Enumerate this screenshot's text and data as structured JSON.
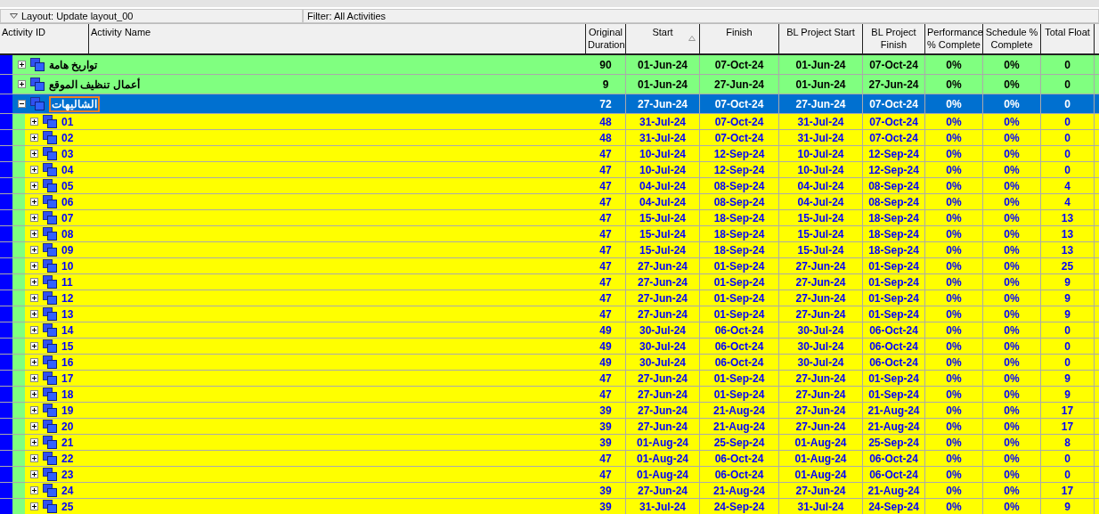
{
  "layout_bar": {
    "layout": "Layout: Update layout_00",
    "filter": "Filter: All Activities"
  },
  "table": {
    "columns": [
      {
        "label": "Activity ID",
        "sorted": false
      },
      {
        "label": "Activity Name",
        "sorted": false
      },
      {
        "label": "Original Duration",
        "sorted": false
      },
      {
        "label": "Start",
        "sorted": true
      },
      {
        "label": "Finish",
        "sorted": false
      },
      {
        "label": "BL Project Start",
        "sorted": false
      },
      {
        "label": "BL Project Finish",
        "sorted": false
      },
      {
        "label": "Performance % Complete",
        "sorted": false
      },
      {
        "label": "Schedule % Complete",
        "sorted": false
      },
      {
        "label": "Total Float",
        "sorted": false
      }
    ],
    "rows": [
      {
        "name": "تواريخ هامة",
        "expanded": false,
        "selected": false,
        "editing": false,
        "values": [
          "90",
          "01-Jun-24",
          "07-Oct-24",
          "01-Jun-24",
          "07-Oct-24",
          "0%",
          "0%",
          "0"
        ]
      },
      {
        "name": "أعمال تنظيف الموقع",
        "expanded": false,
        "selected": false,
        "editing": false,
        "values": [
          "9",
          "01-Jun-24",
          "27-Jun-24",
          "01-Jun-24",
          "27-Jun-24",
          "0%",
          "0%",
          "0"
        ]
      },
      {
        "name": "الشاليهات",
        "expanded": true,
        "selected": true,
        "editing": true,
        "values": [
          "72",
          "27-Jun-24",
          "07-Oct-24",
          "27-Jun-24",
          "07-Oct-24",
          "0%",
          "0%",
          "0"
        ],
        "children": [
          {
            "name": "01",
            "expanded": false,
            "selected": false,
            "editing": false,
            "values": [
              "48",
              "31-Jul-24",
              "07-Oct-24",
              "31-Jul-24",
              "07-Oct-24",
              "0%",
              "0%",
              "0"
            ]
          },
          {
            "name": "02",
            "expanded": false,
            "selected": false,
            "editing": false,
            "values": [
              "48",
              "31-Jul-24",
              "07-Oct-24",
              "31-Jul-24",
              "07-Oct-24",
              "0%",
              "0%",
              "0"
            ]
          },
          {
            "name": "03",
            "expanded": false,
            "selected": false,
            "editing": false,
            "values": [
              "47",
              "10-Jul-24",
              "12-Sep-24",
              "10-Jul-24",
              "12-Sep-24",
              "0%",
              "0%",
              "0"
            ]
          },
          {
            "name": "04",
            "expanded": false,
            "selected": false,
            "editing": false,
            "values": [
              "47",
              "10-Jul-24",
              "12-Sep-24",
              "10-Jul-24",
              "12-Sep-24",
              "0%",
              "0%",
              "0"
            ]
          },
          {
            "name": "05",
            "expanded": false,
            "selected": false,
            "editing": false,
            "values": [
              "47",
              "04-Jul-24",
              "08-Sep-24",
              "04-Jul-24",
              "08-Sep-24",
              "0%",
              "0%",
              "4"
            ]
          },
          {
            "name": "06",
            "expanded": false,
            "selected": false,
            "editing": false,
            "values": [
              "47",
              "04-Jul-24",
              "08-Sep-24",
              "04-Jul-24",
              "08-Sep-24",
              "0%",
              "0%",
              "4"
            ]
          },
          {
            "name": "07",
            "expanded": false,
            "selected": false,
            "editing": false,
            "values": [
              "47",
              "15-Jul-24",
              "18-Sep-24",
              "15-Jul-24",
              "18-Sep-24",
              "0%",
              "0%",
              "13"
            ]
          },
          {
            "name": "08",
            "expanded": false,
            "selected": false,
            "editing": false,
            "values": [
              "47",
              "15-Jul-24",
              "18-Sep-24",
              "15-Jul-24",
              "18-Sep-24",
              "0%",
              "0%",
              "13"
            ]
          },
          {
            "name": "09",
            "expanded": false,
            "selected": false,
            "editing": false,
            "values": [
              "47",
              "15-Jul-24",
              "18-Sep-24",
              "15-Jul-24",
              "18-Sep-24",
              "0%",
              "0%",
              "13"
            ]
          },
          {
            "name": "10",
            "expanded": false,
            "selected": false,
            "editing": false,
            "values": [
              "47",
              "27-Jun-24",
              "01-Sep-24",
              "27-Jun-24",
              "01-Sep-24",
              "0%",
              "0%",
              "25"
            ]
          },
          {
            "name": "11",
            "expanded": false,
            "selected": false,
            "editing": false,
            "values": [
              "47",
              "27-Jun-24",
              "01-Sep-24",
              "27-Jun-24",
              "01-Sep-24",
              "0%",
              "0%",
              "9"
            ]
          },
          {
            "name": "12",
            "expanded": false,
            "selected": false,
            "editing": false,
            "values": [
              "47",
              "27-Jun-24",
              "01-Sep-24",
              "27-Jun-24",
              "01-Sep-24",
              "0%",
              "0%",
              "9"
            ]
          },
          {
            "name": "13",
            "expanded": false,
            "selected": false,
            "editing": false,
            "values": [
              "47",
              "27-Jun-24",
              "01-Sep-24",
              "27-Jun-24",
              "01-Sep-24",
              "0%",
              "0%",
              "9"
            ]
          },
          {
            "name": "14",
            "expanded": false,
            "selected": false,
            "editing": false,
            "values": [
              "49",
              "30-Jul-24",
              "06-Oct-24",
              "30-Jul-24",
              "06-Oct-24",
              "0%",
              "0%",
              "0"
            ]
          },
          {
            "name": "15",
            "expanded": false,
            "selected": false,
            "editing": false,
            "values": [
              "49",
              "30-Jul-24",
              "06-Oct-24",
              "30-Jul-24",
              "06-Oct-24",
              "0%",
              "0%",
              "0"
            ]
          },
          {
            "name": "16",
            "expanded": false,
            "selected": false,
            "editing": false,
            "values": [
              "49",
              "30-Jul-24",
              "06-Oct-24",
              "30-Jul-24",
              "06-Oct-24",
              "0%",
              "0%",
              "0"
            ]
          },
          {
            "name": "17",
            "expanded": false,
            "selected": false,
            "editing": false,
            "values": [
              "47",
              "27-Jun-24",
              "01-Sep-24",
              "27-Jun-24",
              "01-Sep-24",
              "0%",
              "0%",
              "9"
            ]
          },
          {
            "name": "18",
            "expanded": false,
            "selected": false,
            "editing": false,
            "values": [
              "47",
              "27-Jun-24",
              "01-Sep-24",
              "27-Jun-24",
              "01-Sep-24",
              "0%",
              "0%",
              "9"
            ]
          },
          {
            "name": "19",
            "expanded": false,
            "selected": false,
            "editing": false,
            "values": [
              "39",
              "27-Jun-24",
              "21-Aug-24",
              "27-Jun-24",
              "21-Aug-24",
              "0%",
              "0%",
              "17"
            ]
          },
          {
            "name": "20",
            "expanded": false,
            "selected": false,
            "editing": false,
            "values": [
              "39",
              "27-Jun-24",
              "21-Aug-24",
              "27-Jun-24",
              "21-Aug-24",
              "0%",
              "0%",
              "17"
            ]
          },
          {
            "name": "21",
            "expanded": false,
            "selected": false,
            "editing": false,
            "values": [
              "39",
              "01-Aug-24",
              "25-Sep-24",
              "01-Aug-24",
              "25-Sep-24",
              "0%",
              "0%",
              "8"
            ]
          },
          {
            "name": "22",
            "expanded": false,
            "selected": false,
            "editing": false,
            "values": [
              "47",
              "01-Aug-24",
              "06-Oct-24",
              "01-Aug-24",
              "06-Oct-24",
              "0%",
              "0%",
              "0"
            ]
          },
          {
            "name": "23",
            "expanded": false,
            "selected": false,
            "editing": false,
            "values": [
              "47",
              "01-Aug-24",
              "06-Oct-24",
              "01-Aug-24",
              "06-Oct-24",
              "0%",
              "0%",
              "0"
            ]
          },
          {
            "name": "24",
            "expanded": false,
            "selected": false,
            "editing": false,
            "values": [
              "39",
              "27-Jun-24",
              "21-Aug-24",
              "27-Jun-24",
              "21-Aug-24",
              "0%",
              "0%",
              "17"
            ]
          },
          {
            "name": "25",
            "expanded": false,
            "selected": false,
            "editing": false,
            "values": [
              "39",
              "31-Jul-24",
              "24-Sep-24",
              "31-Jul-24",
              "24-Sep-24",
              "0%",
              "0%",
              "9"
            ]
          }
        ]
      }
    ]
  }
}
